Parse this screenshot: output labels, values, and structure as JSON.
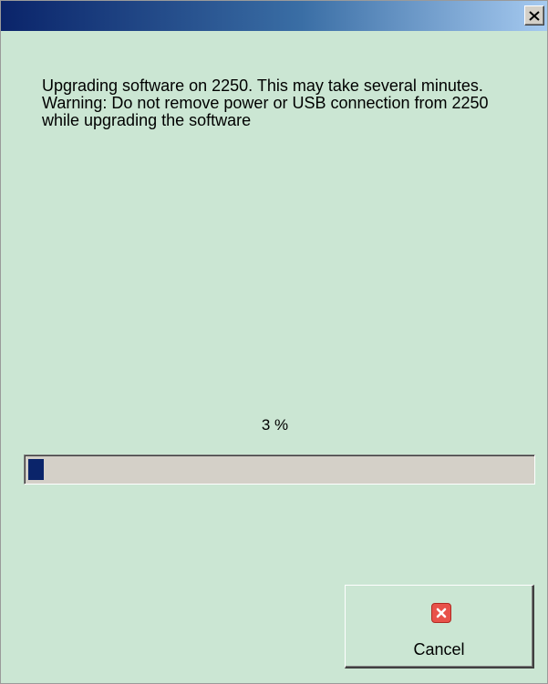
{
  "window": {
    "title": "",
    "titlebar_gradient": [
      "#0a246a",
      "#3a6ea5",
      "#a6caf0"
    ],
    "background": "#cbe6d3"
  },
  "close_button": {
    "icon": "close-icon",
    "glyph": "×"
  },
  "message": {
    "line1": "Upgrading software on 2250. This may take several minutes.",
    "line2": "Warning: Do not remove power or USB connection from 2250 while upgrading the software"
  },
  "progress": {
    "label": "3 %",
    "value_percent": 3,
    "fill_color": "#0a246a"
  },
  "cancel_button": {
    "label": "Cancel",
    "icon": "cancel-x-icon",
    "icon_color": "#e8524a"
  }
}
